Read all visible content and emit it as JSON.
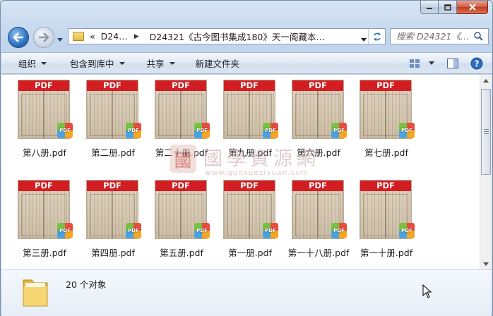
{
  "window": {
    "caption_buttons": {
      "minimize": "minimize",
      "maximize": "maximize",
      "close": "close"
    }
  },
  "address_bar": {
    "prefix": "«",
    "segments": [
      "D24…",
      "D24321《古今图书集成180》天一阁藏本…"
    ]
  },
  "search": {
    "placeholder": "搜索 D24321《…"
  },
  "toolbar": {
    "organize": "组织",
    "include_in_library": "包含到库中",
    "share": "共享",
    "new_folder": "新建文件夹"
  },
  "files": [
    {
      "name": "第八册.pdf",
      "banner": "PDF",
      "badge": "PDF"
    },
    {
      "name": "第二册.pdf",
      "banner": "PDF",
      "badge": "PDF"
    },
    {
      "name": "第二十册.pdf",
      "banner": "PDF",
      "badge": "PDF"
    },
    {
      "name": "第九册.pdf",
      "banner": "PDF",
      "badge": "PDF"
    },
    {
      "name": "第六册.pdf",
      "banner": "PDF",
      "badge": "PDF"
    },
    {
      "name": "第七册.pdf",
      "banner": "PDF",
      "badge": "PDF"
    },
    {
      "name": "第三册.pdf",
      "banner": "PDF",
      "badge": "PDF"
    },
    {
      "name": "第四册.pdf",
      "banner": "PDF",
      "badge": "PDF"
    },
    {
      "name": "第五册.pdf",
      "banner": "PDF",
      "badge": "PDF"
    },
    {
      "name": "第一册.pdf",
      "banner": "PDF",
      "badge": "PDF"
    },
    {
      "name": "第一十八册.pdf",
      "banner": "PDF",
      "badge": "PDF"
    },
    {
      "name": "第一十册.pdf",
      "banner": "PDF",
      "badge": "PDF"
    }
  ],
  "watermark": {
    "seal": "國",
    "title": "國學資源網",
    "url": "www.guoxueziyuan.com"
  },
  "details": {
    "count": "20 个对象"
  },
  "colors": {
    "pdf_banner": "#d21e23",
    "window_bg": "#cfdcec"
  }
}
